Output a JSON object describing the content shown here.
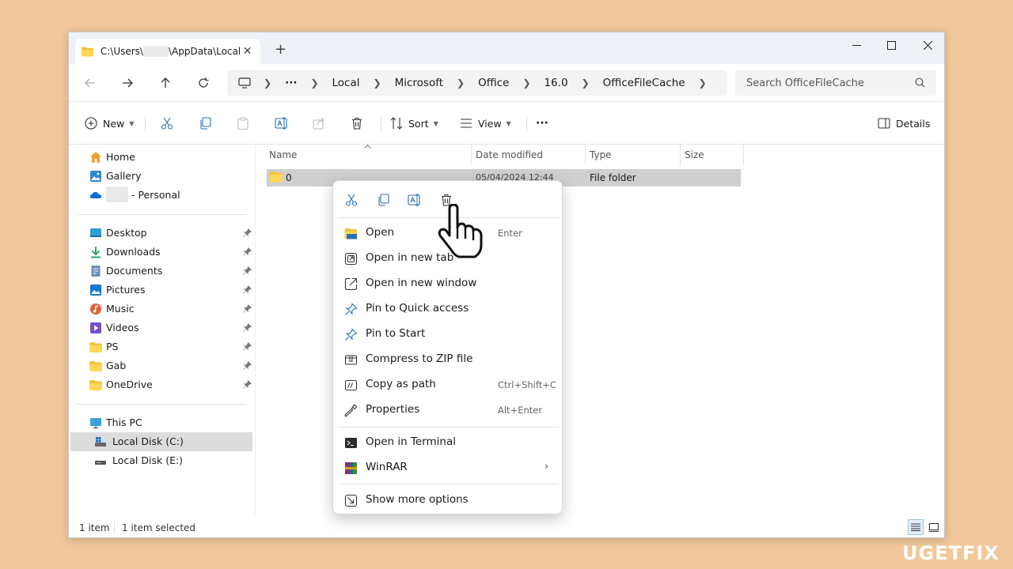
{
  "tab": {
    "title": "C:\\Users\\",
    "title_suffix": "\\AppData\\Local",
    "close": "✕",
    "new": "+"
  },
  "window_controls": {
    "minimize": "—",
    "maximize": "☐",
    "close": "✕"
  },
  "address": {
    "crumbs": [
      "Local",
      "Microsoft",
      "Office",
      "16.0",
      "OfficeFileCache"
    ],
    "more": "···"
  },
  "search": {
    "placeholder": "Search OfficeFileCache"
  },
  "toolbar": {
    "new": "New",
    "sort": "Sort",
    "view": "View",
    "more": "···",
    "details": "Details"
  },
  "sidebar": {
    "home": "Home",
    "gallery": "Gallery",
    "personal": "- Personal",
    "quick": [
      "Desktop",
      "Downloads",
      "Documents",
      "Pictures",
      "Music",
      "Videos",
      "PS",
      "Gab",
      "OneDrive"
    ],
    "this_pc": "This PC",
    "disk_c": "Local Disk (C:)",
    "disk_e": "Local Disk (E:)"
  },
  "columns": {
    "name": "Name",
    "date": "Date modified",
    "type": "Type",
    "size": "Size"
  },
  "files": [
    {
      "name": "0",
      "date": "05/04/2024 12:44",
      "type": "File folder"
    }
  ],
  "status": {
    "count": "1 item",
    "selected": "1 item selected"
  },
  "context_menu": {
    "items": [
      {
        "label": "Open",
        "shortcut": "Enter"
      },
      {
        "label": "Open in new tab",
        "shortcut": ""
      },
      {
        "label": "Open in new window",
        "shortcut": ""
      },
      {
        "label": "Pin to Quick access",
        "shortcut": ""
      },
      {
        "label": "Pin to Start",
        "shortcut": ""
      },
      {
        "label": "Compress to ZIP file",
        "shortcut": ""
      },
      {
        "label": "Copy as path",
        "shortcut": "Ctrl+Shift+C"
      },
      {
        "label": "Properties",
        "shortcut": "Alt+Enter"
      },
      {
        "label": "Open in Terminal",
        "shortcut": ""
      },
      {
        "label": "WinRAR",
        "shortcut": ""
      },
      {
        "label": "Show more options",
        "shortcut": ""
      }
    ]
  },
  "watermark": "UGETFIX",
  "colors": {
    "background": "#f0c89a",
    "selection": "#cfcfcf",
    "accent": "#0067c0"
  },
  "icons": [
    "folder-icon",
    "cut-icon",
    "copy-icon",
    "paste-icon",
    "rename-icon",
    "share-icon",
    "delete-icon",
    "sort-icon",
    "view-icon",
    "details-icon",
    "home-icon",
    "gallery-icon",
    "onedrive-icon",
    "pin-icon",
    "terminal-icon",
    "winrar-icon",
    "properties-icon",
    "hand-cursor-icon"
  ]
}
